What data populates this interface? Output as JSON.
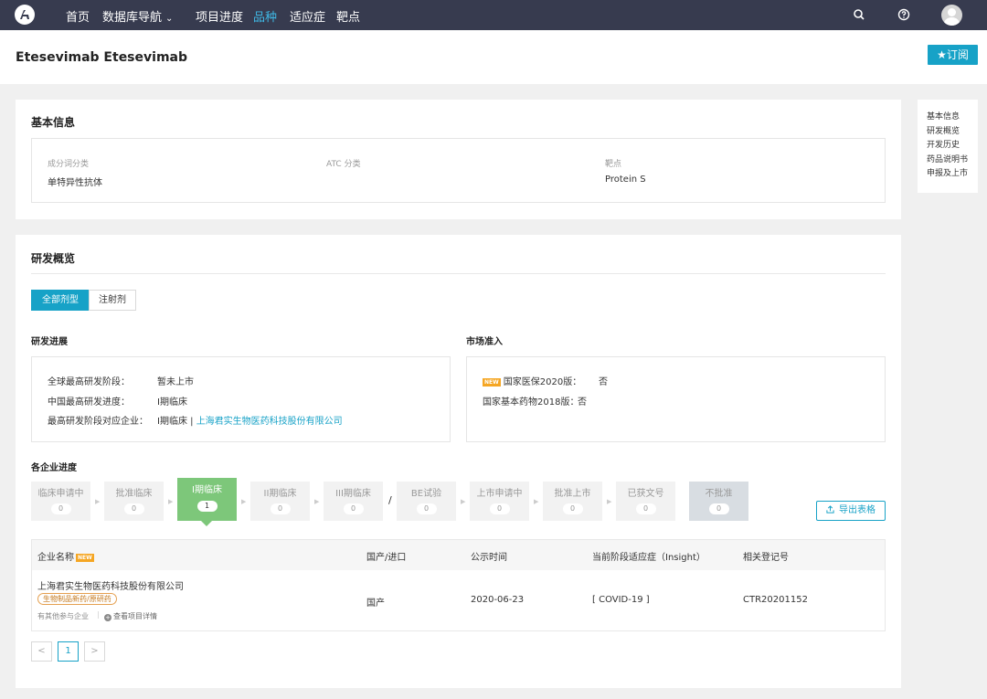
{
  "nav": {
    "items": [
      {
        "label": "首页"
      },
      {
        "label": "数据库导航"
      },
      {
        "label": "项目进度"
      },
      {
        "label": "品种"
      },
      {
        "label": "适应症"
      },
      {
        "label": "靶点"
      }
    ],
    "dropdown_glyph": "⌄"
  },
  "page": {
    "title": "Etesevimab Etesevimab",
    "subscribe_label": "★订阅"
  },
  "side_nav": [
    "基本信息",
    "研发概览",
    "开发历史",
    "药品说明书",
    "申报及上市"
  ],
  "basic_info": {
    "title": "基本信息",
    "fields": [
      {
        "label": "成分词分类",
        "value": "单特异性抗体"
      },
      {
        "label": "ATC 分类",
        "value": ""
      },
      {
        "label": "靶点",
        "value": "Protein S"
      }
    ]
  },
  "overview": {
    "title": "研发概览",
    "tabs": [
      {
        "label": "全部剂型",
        "active": true
      },
      {
        "label": "注射剂",
        "active": false
      }
    ],
    "progress": {
      "title": "研发进展",
      "rows": [
        {
          "label": "全球最高研发阶段：",
          "value": "暂未上市"
        },
        {
          "label": "中国最高研发进度：",
          "value": "I期临床"
        },
        {
          "label": "最高研发阶段对应企业：",
          "value": "I期临床 | ",
          "link": "上海君实生物医药科技股份有限公司"
        }
      ]
    },
    "market": {
      "title": "市场准入",
      "badge": "NEW",
      "rows": [
        {
          "label": "国家医保2020版：",
          "value": "否"
        },
        {
          "label": "国家基本药物2018版：",
          "value": "否"
        }
      ]
    },
    "company_progress": {
      "title": "各企业进度",
      "stages": [
        {
          "label": "临床申请中",
          "count": "0"
        },
        {
          "label": "批准临床",
          "count": "0"
        },
        {
          "label": "I期临床",
          "count": "1"
        },
        {
          "label": "II期临床",
          "count": "0"
        },
        {
          "label": "III期临床",
          "count": "0"
        },
        {
          "label": "BE试验",
          "count": "0"
        },
        {
          "label": "上市申请中",
          "count": "0"
        },
        {
          "label": "批准上市",
          "count": "0"
        },
        {
          "label": "已获文号",
          "count": "0"
        },
        {
          "label": "不批准",
          "count": "0"
        }
      ],
      "slash": "/",
      "export_label": "导出表格"
    },
    "table": {
      "headers": [
        "企业名称",
        "国产/进口",
        "公示时间",
        "当前阶段适应症（Insight）",
        "相关登记号"
      ],
      "header_badge": "NEW",
      "rows": [
        {
          "company": "上海君实生物医药科技股份有限公司",
          "tag": "生物制品新药/原研药",
          "other_link": "有其他参与企业",
          "detail_link": "查看项目详情",
          "origin": "国产",
          "date": "2020-06-23",
          "indication": "[ COVID-19 ]",
          "reg_no": "CTR20201152"
        }
      ]
    },
    "pagination": {
      "prev": "<",
      "current": "1",
      "next": ">"
    }
  },
  "colors": {
    "accent": "#17a2c7",
    "nav_bg": "#373b4f",
    "active_stage": "#7dc77a",
    "badge": "#f5a623"
  },
  "icons": [
    "logo-icon",
    "search-icon",
    "help-icon",
    "user-avatar-icon",
    "export-icon",
    "plus-circle-icon"
  ]
}
